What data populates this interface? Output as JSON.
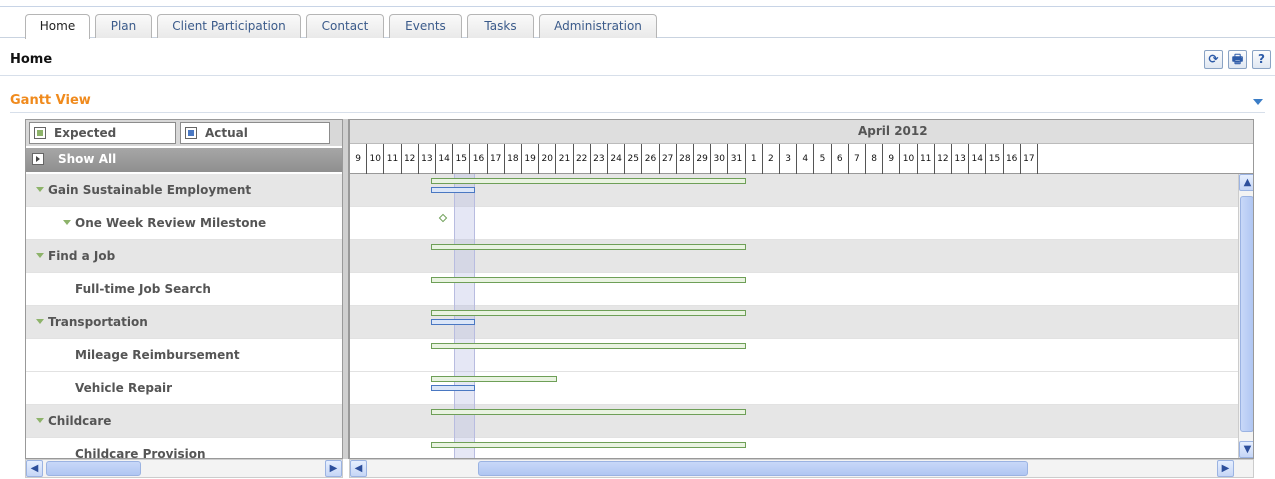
{
  "tabs": [
    "Home",
    "Plan",
    "Client Participation",
    "Contact",
    "Events",
    "Tasks",
    "Administration"
  ],
  "active_tab": "Home",
  "header": {
    "title": "Home",
    "buttons": [
      {
        "name": "refresh-icon",
        "glyph": "⟳"
      },
      {
        "name": "print-icon",
        "glyph": "🖶"
      },
      {
        "name": "help-icon",
        "glyph": "?"
      }
    ]
  },
  "section": {
    "title": "Gantt View"
  },
  "legend": {
    "expected": "Expected",
    "actual": "Actual",
    "expected_color": "#8db36a",
    "actual_color": "#4a78c2"
  },
  "show_all": "Show All",
  "tasks": [
    {
      "label": "Gain Sustainable Employment",
      "indent": 1,
      "expandable": true
    },
    {
      "label": "One Week Review Milestone",
      "indent": 2,
      "expandable": true
    },
    {
      "label": "Find a Job",
      "indent": 1,
      "expandable": true
    },
    {
      "label": "Full-time Job Search",
      "indent": 2,
      "expandable": false
    },
    {
      "label": "Transportation",
      "indent": 1,
      "expandable": true
    },
    {
      "label": "Mileage Reimbursement",
      "indent": 2,
      "expandable": false
    },
    {
      "label": "Vehicle Repair",
      "indent": 2,
      "expandable": false
    },
    {
      "label": "Childcare",
      "indent": 1,
      "expandable": true
    },
    {
      "label": "Childcare Provision",
      "indent": 2,
      "expandable": false
    }
  ],
  "timeline": {
    "month": "April 2012",
    "days": [
      "9",
      "10",
      "11",
      "12",
      "13",
      "14",
      "15",
      "16",
      "17",
      "18",
      "19",
      "20",
      "21",
      "22",
      "23",
      "24",
      "25",
      "26",
      "27",
      "28",
      "29",
      "30",
      "31",
      "1",
      "2",
      "3",
      "4",
      "5",
      "6",
      "7",
      "8",
      "9",
      "10",
      "11",
      "12",
      "13",
      "14",
      "15",
      "16",
      "17"
    ]
  },
  "bars": [
    {
      "row": 0,
      "expected": [
        13,
        31
      ],
      "actual": [
        13,
        14
      ]
    },
    {
      "row": 1,
      "milestone": 14
    },
    {
      "row": 2,
      "expected": [
        13,
        31
      ]
    },
    {
      "row": 3,
      "expected": [
        13,
        31
      ]
    },
    {
      "row": 4,
      "expected": [
        13,
        31
      ],
      "actual": [
        13,
        14
      ]
    },
    {
      "row": 5,
      "expected": [
        13,
        31
      ]
    },
    {
      "row": 6,
      "expected": [
        13,
        20
      ],
      "actual": [
        13,
        14
      ]
    },
    {
      "row": 7,
      "expected": [
        13,
        31
      ]
    },
    {
      "row": 8,
      "expected": [
        13,
        31
      ]
    }
  ]
}
